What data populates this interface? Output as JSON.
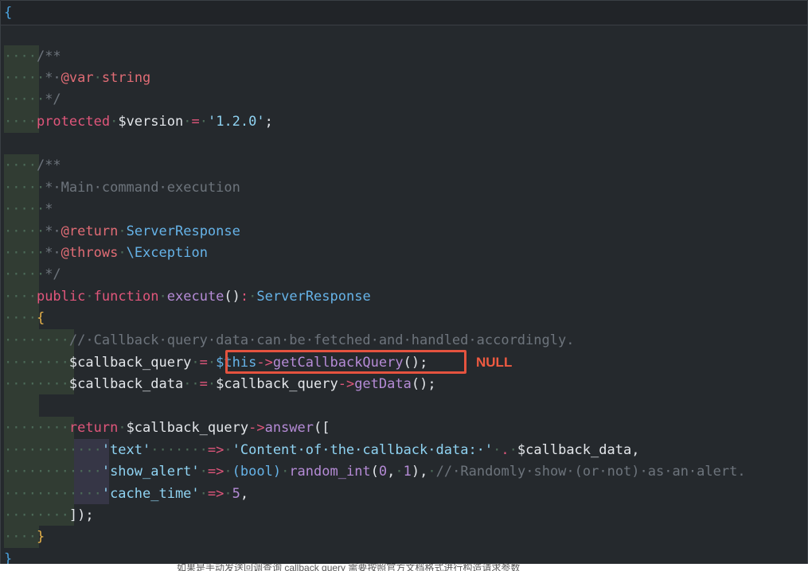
{
  "code": {
    "open_brace": "{",
    "close_brace": "}",
    "doc1_open": "/**",
    "doc1_var_tag": "@var",
    "doc1_var_type": "string",
    "doc1_close": "*/",
    "version_keyword": "protected",
    "version_var": "$version",
    "version_value": "'1.2.0'",
    "doc2_open": "/**",
    "doc2_desc": "Main·command·execution",
    "doc2_return_tag": "@return",
    "doc2_return_type": "ServerResponse",
    "doc2_throws_tag": "@throws",
    "doc2_throws_type": "\\Exception",
    "doc2_close": "*/",
    "method_public": "public",
    "method_function": "function",
    "method_name": "execute",
    "method_return_type": "ServerResponse",
    "method_open": "{",
    "comment_line": "//·Callback·query·data·can·be·fetched·and·handled·accordingly.",
    "cq_var": "$callback_query",
    "cq_this": "$this",
    "cq_call": "getCallbackQuery",
    "cd_var": "$callback_data",
    "cd_src": "$callback_query",
    "cd_call": "getData",
    "return_kw": "return",
    "return_var": "$callback_query",
    "return_call": "answer",
    "text_key": "'text'",
    "text_value": "'Content·of·the·callback·data:·'",
    "text_concat_var": "$callback_data",
    "alert_key": "'show_alert'",
    "alert_cast": "(bool)",
    "alert_fn": "random_int",
    "alert_arg1": "0",
    "alert_arg2": "1",
    "alert_comment": "//·Randomly·show·(or·not)·as·an·alert.",
    "cache_key": "'cache_time'",
    "cache_value": "5",
    "array_close": "]);",
    "method_close": "}"
  },
  "annotation": {
    "label": "NULL",
    "color": "#ef5a41"
  },
  "bottom_caption": "如果是手动发送回调查询 callback query 需要按照官方文档格式进行构造请求参数"
}
